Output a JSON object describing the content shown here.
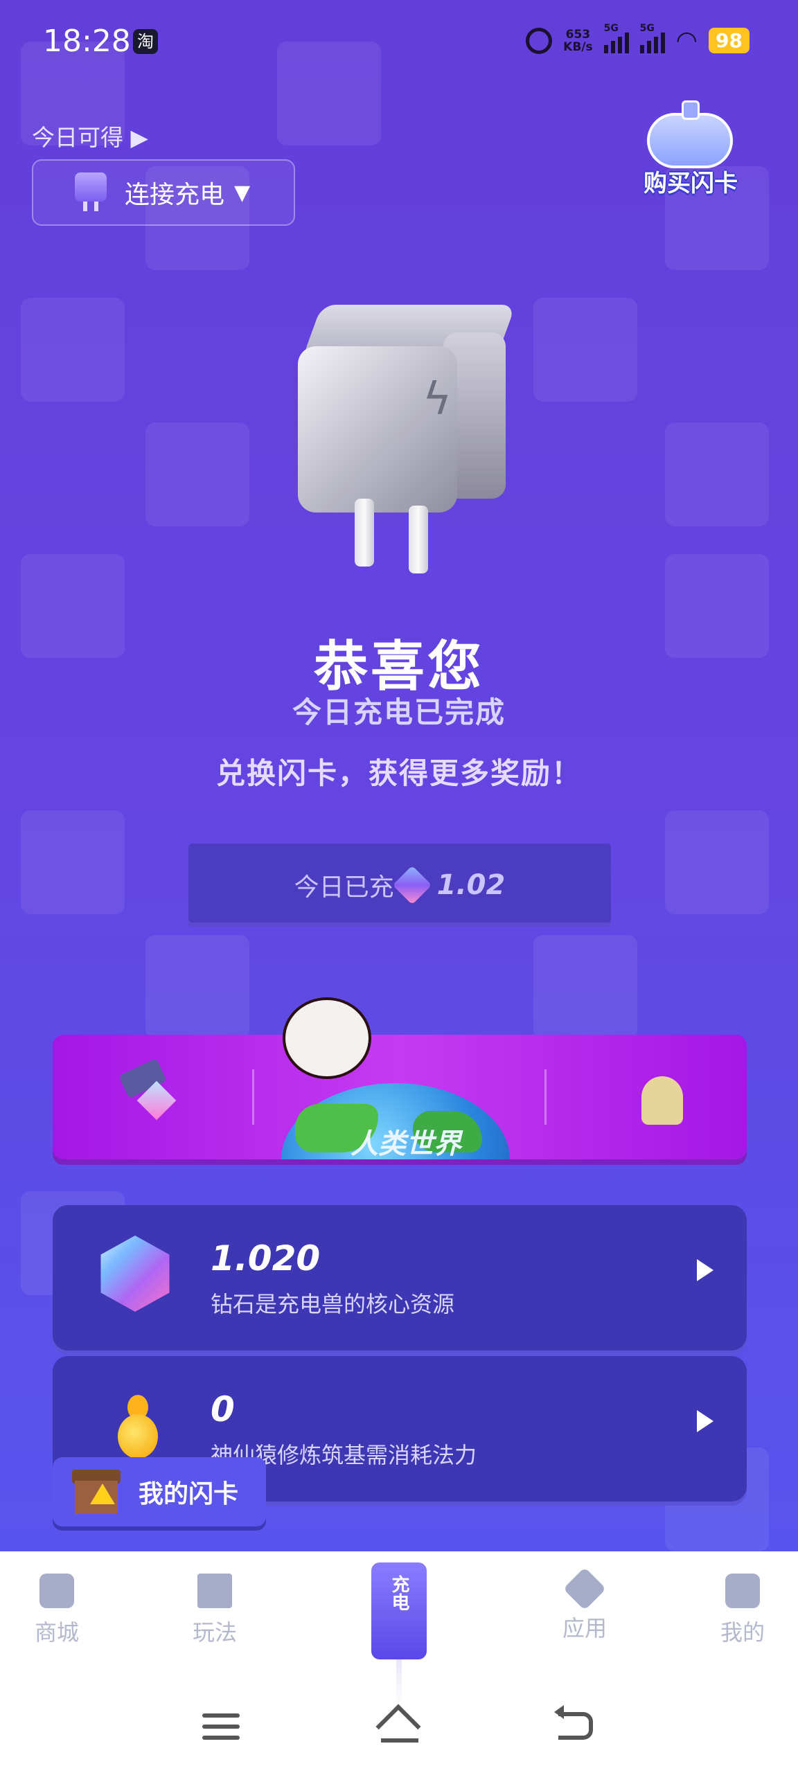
{
  "status_bar": {
    "time": "18:28",
    "app_badge": "淘",
    "net_speed_top": "653",
    "net_speed_bottom": "KB/s",
    "sim1": "5G",
    "sim2": "5G",
    "battery": "98"
  },
  "header": {
    "today_available": "今日可得 ▶",
    "connect_label": "连接充电",
    "connect_caret": "▼",
    "buy_card_label": "购买闪卡"
  },
  "hero": {
    "congrats": "恭喜您",
    "done": "今日充电已完成",
    "exchange": "兑换闪卡，获得更多奖励！"
  },
  "charged": {
    "label": "今日已充",
    "value": "1.02"
  },
  "banner": {
    "world_label": "人类世界"
  },
  "resources": [
    {
      "value": "1.020",
      "desc": "钻石是充电兽的核心资源",
      "icon": "diamond-icon"
    },
    {
      "value": "0",
      "desc": "神仙猿修炼筑基需消耗法力",
      "icon": "gourd-icon"
    }
  ],
  "my_card": {
    "label": "我的闪卡"
  },
  "tabbar": {
    "tabs": [
      {
        "label": "商城",
        "icon": "shop-icon"
      },
      {
        "label": "玩法",
        "icon": "play-icon"
      },
      {
        "label": "充电",
        "icon": "charge-icon"
      },
      {
        "label": "应用",
        "icon": "apps-icon"
      },
      {
        "label": "我的",
        "icon": "profile-icon"
      }
    ],
    "center_text": "充电"
  },
  "colors": {
    "bg_top": "#5a34d8",
    "bg_bottom": "#4a4ef0",
    "banner": "#b42cea",
    "card": "#3e37b4",
    "battery": "#ffc21f"
  }
}
